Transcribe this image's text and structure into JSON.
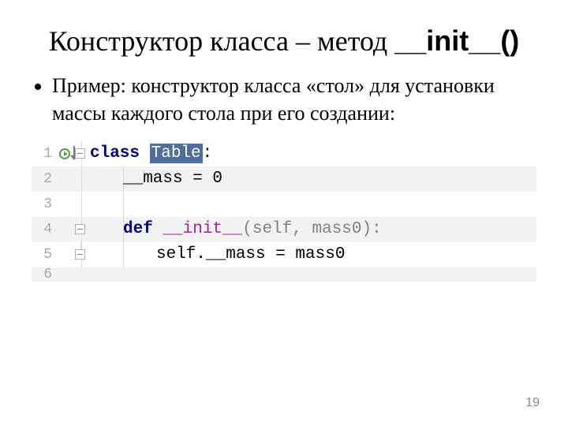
{
  "title_part1": "Конструктор класса – метод ",
  "title_method": "__init__()",
  "bullet_prefix": "Пример: конструктор класса ",
  "bullet_quoted": "«стол»",
  "bullet_suffix": " для установки массы каждого стола при его создании:",
  "code": {
    "lines": [
      "1",
      "2",
      "3",
      "4",
      "5",
      "6"
    ],
    "kw_class": "class ",
    "class_name": "Table",
    "colon": ":",
    "mass_attr": "__mass = 0",
    "kw_def": "def ",
    "init_name": "__init__",
    "init_params": "(self, mass0):",
    "assign": "self.__mass = mass0"
  },
  "page_number": "19"
}
